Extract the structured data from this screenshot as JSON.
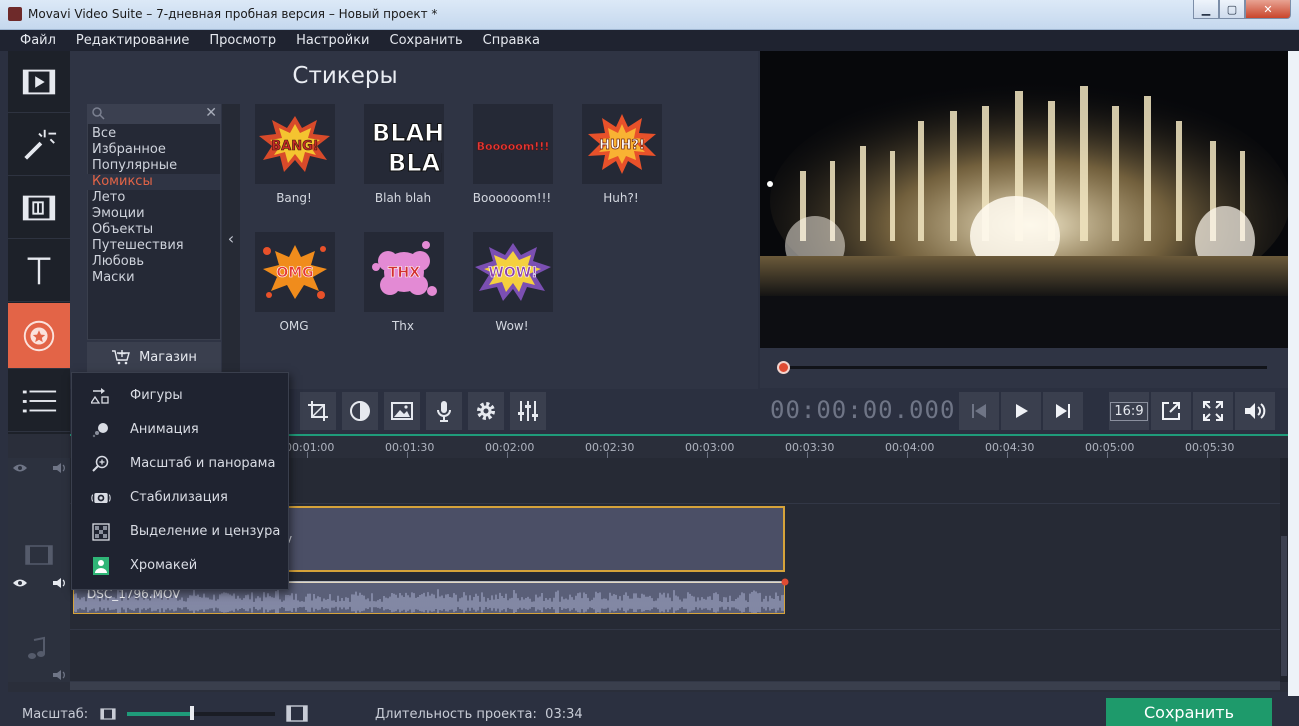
{
  "window": {
    "title": "Movavi Video Suite – 7-дневная пробная версия – Новый проект *",
    "min": "▁",
    "max": "▢",
    "close": "✕"
  },
  "menu": [
    "Файл",
    "Редактирование",
    "Просмотр",
    "Настройки",
    "Сохранить",
    "Справка"
  ],
  "sidebar": {
    "items": [
      {
        "name": "import-icon"
      },
      {
        "name": "filters-icon"
      },
      {
        "name": "transitions-icon"
      },
      {
        "name": "titles-icon"
      },
      {
        "name": "stickers-icon",
        "active": true
      },
      {
        "name": "more-tools-icon"
      }
    ],
    "accent": "#e36447"
  },
  "stickers_panel": {
    "title": "Стикеры",
    "search_placeholder": "",
    "clear": "✕",
    "categories": [
      "Все",
      "Избранное",
      "Популярные",
      "Комиксы",
      "Лето",
      "Эмоции",
      "Объекты",
      "Путешествия",
      "Любовь",
      "Маски"
    ],
    "selected_category": "Комиксы",
    "shop_label": "Магазин",
    "collapse": "‹",
    "items": [
      {
        "label": "Bang!",
        "art": "BANG!"
      },
      {
        "label": "Blah blah",
        "art": "BLAH BLAH"
      },
      {
        "label": "Boooooom!!!",
        "art": "Booooom!!!"
      },
      {
        "label": "Huh?!",
        "art": "HUH?!"
      },
      {
        "label": "OMG",
        "art": "OMG"
      },
      {
        "label": "Thx",
        "art": "THX"
      },
      {
        "label": "Wow!",
        "art": "WOW!"
      }
    ]
  },
  "player": {
    "timecode": "00:00:00.000",
    "position": 0,
    "ratio": "16:9"
  },
  "toolbar_tools": [
    "crop-icon",
    "color-adjust-icon",
    "image-icon",
    "microphone-icon",
    "settings-icon",
    "equalizer-icon"
  ],
  "tools_menu": [
    {
      "label": "Фигуры",
      "icon": "shapes-icon"
    },
    {
      "label": "Анимация",
      "icon": "animation-icon"
    },
    {
      "label": "Масштаб и панорама",
      "icon": "zoom-pan-icon"
    },
    {
      "label": "Стабилизация",
      "icon": "stabilization-icon"
    },
    {
      "label": "Выделение и цензура",
      "icon": "censor-icon"
    },
    {
      "label": "Хромакей",
      "icon": "chromakey-icon"
    }
  ],
  "timeline": {
    "ticks": [
      "00:01:00",
      "00:01:30",
      "00:02:00",
      "00:02:30",
      "00:03:00",
      "00:03:30",
      "00:04:00",
      "00:04:30",
      "00:05:00",
      "00:05:30"
    ],
    "video_clip": "v",
    "audio_clip": "DSC_1796.MOV"
  },
  "status": {
    "scale_label": "Масштаб:",
    "scale_value": 0.44,
    "duration_label": "Длительность проекта:",
    "duration": "03:34",
    "save_button": "Сохранить"
  }
}
